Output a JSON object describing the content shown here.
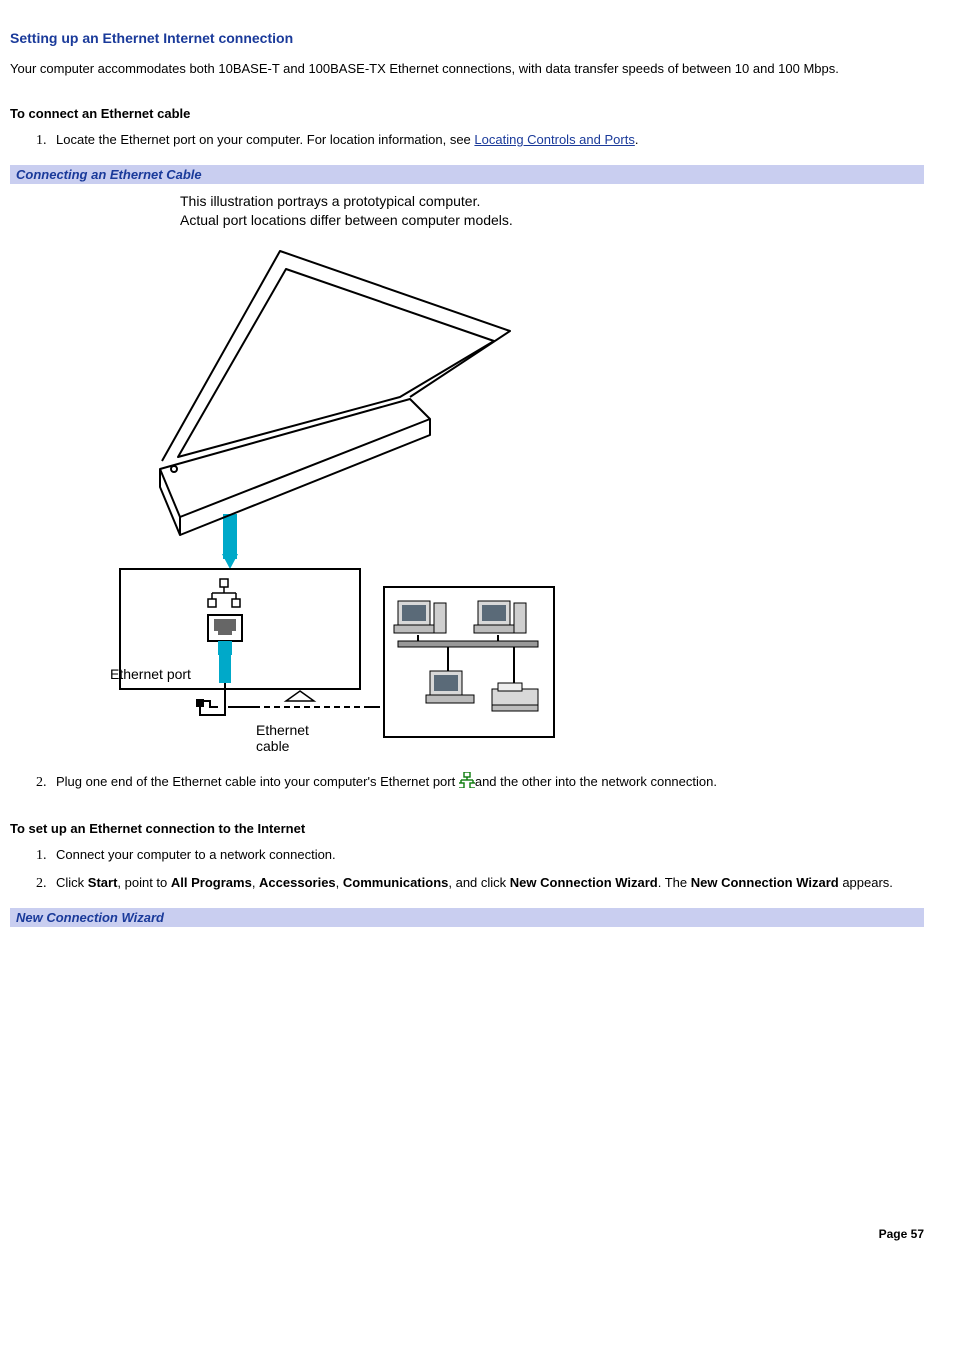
{
  "title": "Setting up an Ethernet Internet connection",
  "intro": "Your computer accommodates both 10BASE-T and 100BASE-TX Ethernet connections, with data transfer speeds of between 10 and 100 Mbps.",
  "section_a": {
    "heading": "To connect an Ethernet cable",
    "step1_pre": "Locate the Ethernet port on your computer. For location information, see ",
    "step1_link": "Locating Controls and Ports",
    "step1_post": ".",
    "bar": "Connecting an Ethernet Cable",
    "caption_l1": "This illustration portrays a prototypical computer.",
    "caption_l2": "Actual port locations differ between computer models.",
    "diagram": {
      "port_label": "Ethernet port",
      "cable_label_l1": "Ethernet",
      "cable_label_l2": "cable"
    },
    "step2_pre": "Plug one end of the Ethernet cable into your computer's Ethernet port ",
    "step2_post": "and the other into the network connection."
  },
  "section_b": {
    "heading": "To set up an Ethernet connection to the Internet",
    "step1": "Connect your computer to a network connection.",
    "step2": {
      "t1": "Click ",
      "b1": "Start",
      "t2": ", point to ",
      "b2": "All Programs",
      "t3": ", ",
      "b3": "Accessories",
      "t4": ", ",
      "b4": "Communications",
      "t5": ", and click ",
      "b5": "New Connection Wizard",
      "t6": ". The ",
      "b6": "New Connection Wizard",
      "t7": " appears."
    },
    "bar": "New Connection Wizard"
  },
  "footer": "Page 57"
}
